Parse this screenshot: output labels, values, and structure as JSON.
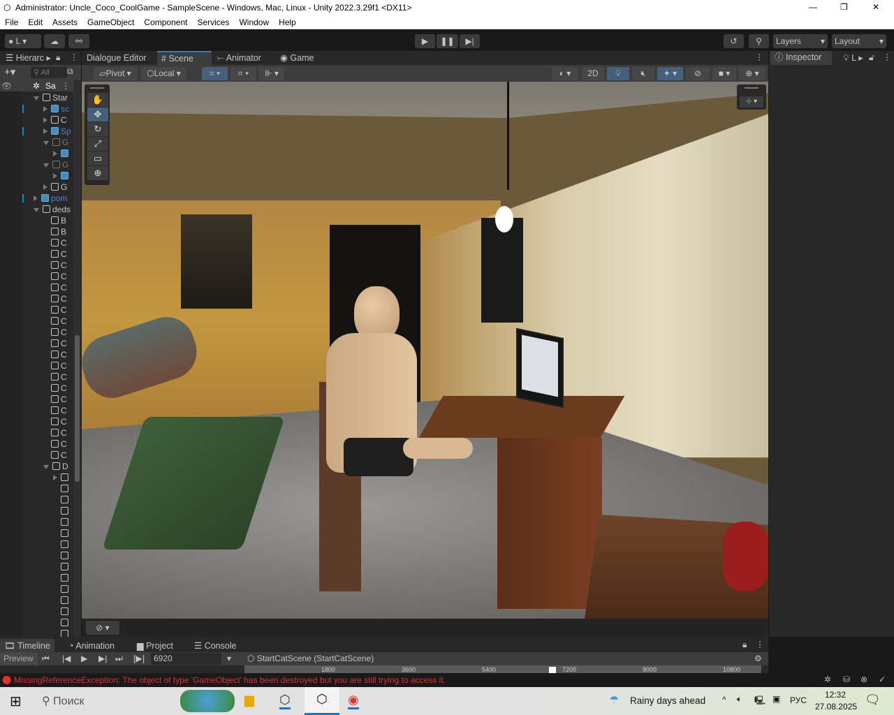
{
  "window": {
    "title": "Administrator: Uncle_Coco_CoolGame - SampleScene - Windows, Mac, Linux - Unity 2022.3.29f1 <DX11>",
    "minimize": "—",
    "maximize": "❐",
    "close": "✕"
  },
  "menu": [
    "File",
    "Edit",
    "Assets",
    "GameObject",
    "Component",
    "Services",
    "Window",
    "Help"
  ],
  "toolbar": {
    "account": "L",
    "layers": "Layers",
    "layout": "Layout"
  },
  "hierarchy": {
    "tab": "Hierarc",
    "search_placeholder": "All",
    "scene": "Sa",
    "rows": [
      {
        "label": "Star",
        "indent": 0,
        "exp": "down",
        "pre": false,
        "dim": false
      },
      {
        "label": "sc",
        "indent": 1,
        "exp": "right",
        "pre": true,
        "dim": false,
        "blue": true
      },
      {
        "label": "C",
        "indent": 1,
        "exp": "right",
        "pre": false,
        "dim": false
      },
      {
        "label": "Sp",
        "indent": 1,
        "exp": "right",
        "pre": true,
        "dim": false,
        "blue": true
      },
      {
        "label": "G",
        "indent": 1,
        "exp": "down",
        "pre": false,
        "dim": true
      },
      {
        "label": "",
        "indent": 2,
        "exp": "right",
        "pre": true,
        "dim": false
      },
      {
        "label": "G",
        "indent": 1,
        "exp": "down",
        "pre": false,
        "dim": true
      },
      {
        "label": "",
        "indent": 2,
        "exp": "right",
        "pre": true,
        "dim": false
      },
      {
        "label": "G",
        "indent": 1,
        "exp": "right",
        "pre": false,
        "dim": false
      },
      {
        "label": "pom",
        "indent": 0,
        "exp": "right",
        "pre": true,
        "dim": false,
        "blue": true
      },
      {
        "label": "deds",
        "indent": 0,
        "exp": "down",
        "pre": false,
        "dim": false
      },
      {
        "label": "B",
        "indent": 1
      },
      {
        "label": "B",
        "indent": 1
      },
      {
        "label": "C",
        "indent": 1
      },
      {
        "label": "C",
        "indent": 1
      },
      {
        "label": "C",
        "indent": 1
      },
      {
        "label": "C",
        "indent": 1
      },
      {
        "label": "C",
        "indent": 1
      },
      {
        "label": "C",
        "indent": 1
      },
      {
        "label": "C",
        "indent": 1
      },
      {
        "label": "C",
        "indent": 1
      },
      {
        "label": "C",
        "indent": 1
      },
      {
        "label": "C",
        "indent": 1
      },
      {
        "label": "C",
        "indent": 1
      },
      {
        "label": "C",
        "indent": 1
      },
      {
        "label": "C",
        "indent": 1
      },
      {
        "label": "C",
        "indent": 1
      },
      {
        "label": "C",
        "indent": 1
      },
      {
        "label": "C",
        "indent": 1
      },
      {
        "label": "C",
        "indent": 1
      },
      {
        "label": "C",
        "indent": 1
      },
      {
        "label": "C",
        "indent": 1
      },
      {
        "label": "C",
        "indent": 1
      },
      {
        "label": "D",
        "indent": 1,
        "exp": "down"
      },
      {
        "label": "",
        "indent": 2,
        "exp": "right"
      },
      {
        "label": "",
        "indent": 2
      },
      {
        "label": "",
        "indent": 2
      },
      {
        "label": "",
        "indent": 2
      },
      {
        "label": "",
        "indent": 2
      },
      {
        "label": "",
        "indent": 2
      },
      {
        "label": "",
        "indent": 2
      },
      {
        "label": "",
        "indent": 2
      },
      {
        "label": "",
        "indent": 2
      },
      {
        "label": "",
        "indent": 2
      },
      {
        "label": "",
        "indent": 2
      },
      {
        "label": "",
        "indent": 2
      },
      {
        "label": "",
        "indent": 2
      },
      {
        "label": "",
        "indent": 2
      },
      {
        "label": "",
        "indent": 2
      },
      {
        "label": "",
        "indent": 2
      }
    ]
  },
  "scene_tabs": [
    "Dialogue Editor",
    "Scene",
    "Animator",
    "Game"
  ],
  "scene_toolbar": {
    "pivot": "Pivot",
    "local": "Local",
    "mode2d": "2D"
  },
  "scene_tools": [
    "✋",
    "✥",
    "↻",
    "⤢",
    "▭",
    "⊕"
  ],
  "inspector": {
    "tab": "Inspector",
    "lighting_tab": "L"
  },
  "bottom_tabs": [
    "Timeline",
    "Animation",
    "Project",
    "Console"
  ],
  "timeline": {
    "preview": "Preview",
    "frame": "6920",
    "asset": "StartCatScene (StartCatScene)",
    "ticks": [
      "1800",
      "3600",
      "5400",
      "7200",
      "9000",
      "10800"
    ]
  },
  "status": {
    "error": "MissingReferenceException: The object of type 'GameObject' has been destroyed but you are still trying to access it."
  },
  "taskbar": {
    "search": "Поиск",
    "weather": "Rainy days ahead",
    "lang": "РУС",
    "time": "12:32",
    "date": "27.08.2025"
  }
}
